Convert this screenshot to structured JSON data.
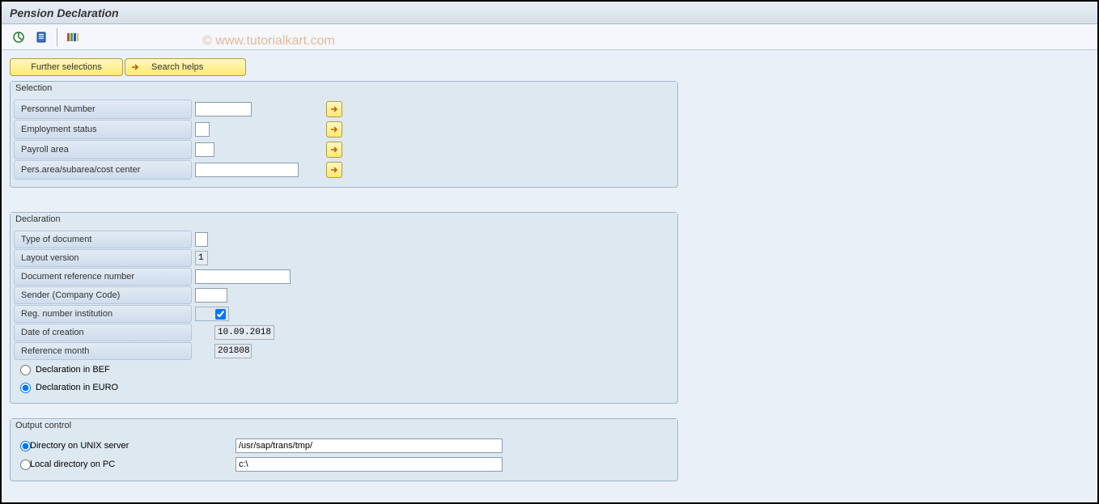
{
  "title": "Pension Declaration",
  "watermark": "© www.tutorialkart.com",
  "toolbar_buttons": {
    "further_selections": "Further selections",
    "search_helps": "Search helps"
  },
  "groups": {
    "selection": {
      "title": "Selection",
      "fields": {
        "personnel_number": {
          "label": "Personnel Number",
          "value": ""
        },
        "employment_status": {
          "label": "Employment status",
          "value": ""
        },
        "payroll_area": {
          "label": "Payroll area",
          "value": ""
        },
        "pers_area": {
          "label": "Pers.area/subarea/cost center",
          "value": ""
        }
      }
    },
    "declaration": {
      "title": "Declaration",
      "fields": {
        "type_of_document": {
          "label": "Type of document",
          "value": ""
        },
        "layout_version": {
          "label": "Layout version",
          "value": "1"
        },
        "doc_ref_number": {
          "label": "Document reference number",
          "value": ""
        },
        "sender": {
          "label": "Sender (Company Code)",
          "value": ""
        },
        "reg_number_inst": {
          "label": "Reg. number institution",
          "checked": true
        },
        "date_of_creation": {
          "label": "Date of creation",
          "value": "10.09.2018"
        },
        "reference_month": {
          "label": "Reference month",
          "value": "201808"
        }
      },
      "radios": {
        "bef": "Declaration in BEF",
        "euro": "Declaration in EURO"
      },
      "radio_selected": "euro"
    },
    "output_control": {
      "title": "Output control",
      "radios": {
        "unix": {
          "label": "Directory on UNIX server",
          "value": "/usr/sap/trans/tmp/"
        },
        "pc": {
          "label": "Local directory on PC",
          "value": "c:\\"
        }
      },
      "radio_selected": "unix"
    }
  }
}
